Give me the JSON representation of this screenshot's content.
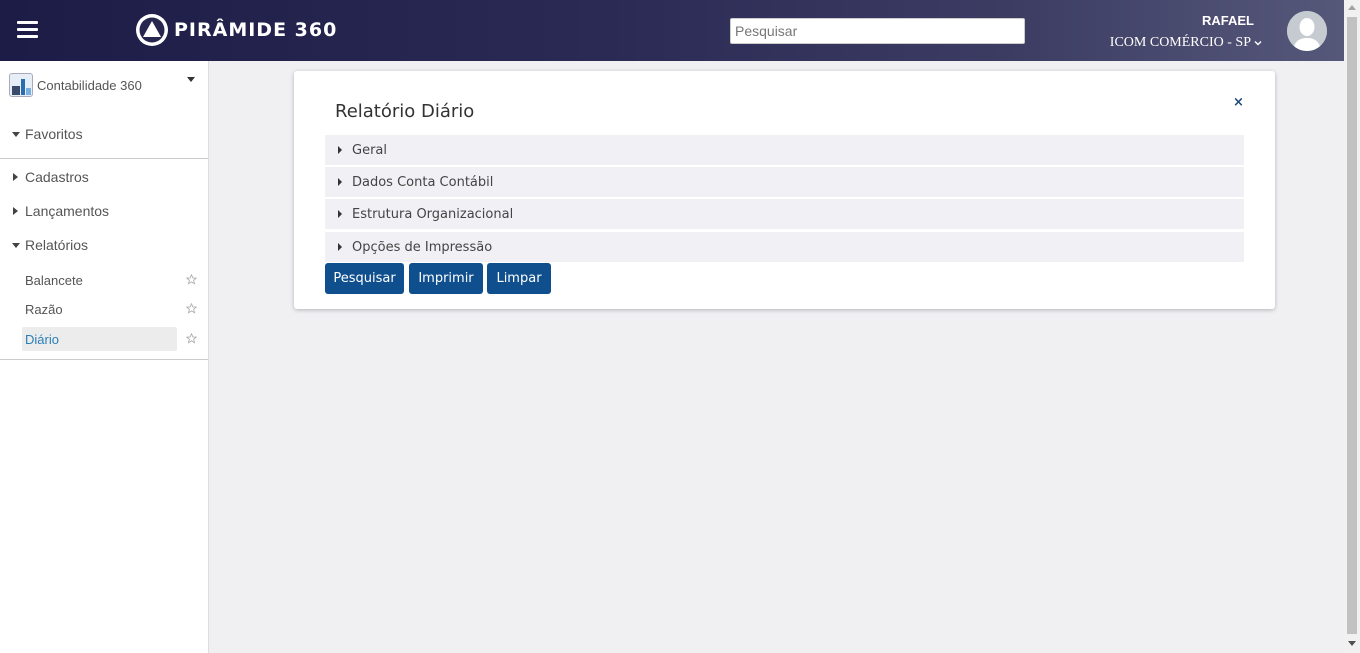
{
  "header": {
    "brand": "PIRÂMIDE 360",
    "search_placeholder": "Pesquisar",
    "user_name": "RAFAEL",
    "company": "ICOM COMÉRCIO - SP"
  },
  "sidebar": {
    "module": "Contabilidade 360",
    "favorites": "Favoritos",
    "sections": [
      {
        "label": "Cadastros",
        "expanded": false
      },
      {
        "label": "Lançamentos",
        "expanded": false
      },
      {
        "label": "Relatórios",
        "expanded": true
      }
    ],
    "reports": [
      {
        "label": "Balancete",
        "active": false
      },
      {
        "label": "Razão",
        "active": false
      },
      {
        "label": "Diário",
        "active": true
      }
    ]
  },
  "panel": {
    "title": "Relatório Diário",
    "close": "×",
    "accordion": [
      "Geral",
      "Dados Conta Contábil",
      "Estrutura Organizacional",
      "Opções de Impressão"
    ],
    "buttons": {
      "search": "Pesquisar",
      "print": "Imprimir",
      "clear": "Limpar"
    }
  },
  "colors": {
    "header_start": "#1c1c46",
    "header_end": "#56587a",
    "button": "#0f4f8d",
    "active_link": "#2a7fb8"
  }
}
